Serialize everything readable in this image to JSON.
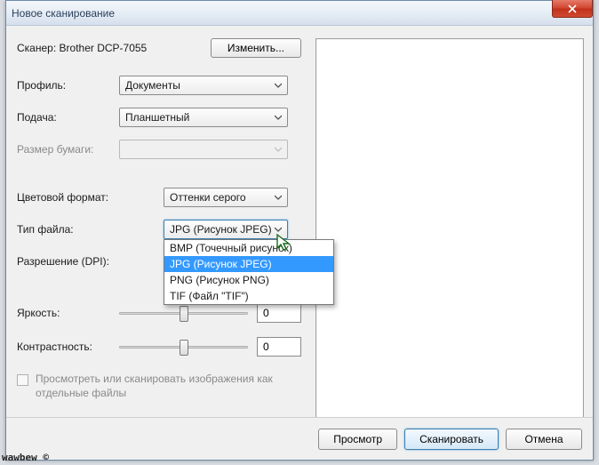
{
  "title": "Новое сканирование",
  "scanner": {
    "label": "Сканер:",
    "name": "Brother DCP-7055",
    "change_btn": "Изменить..."
  },
  "profile": {
    "label": "Профиль:",
    "value": "Документы"
  },
  "feed": {
    "label": "Подача:",
    "value": "Планшетный"
  },
  "paper_size": {
    "label": "Размер бумаги:",
    "value": ""
  },
  "color_format": {
    "label": "Цветовой формат:",
    "value": "Оттенки серого"
  },
  "file_type": {
    "label": "Тип файла:",
    "value": "JPG (Рисунок JPEG)",
    "options": [
      "BMP (Точечный рисунок)",
      "JPG (Рисунок JPEG)",
      "PNG (Рисунок PNG)",
      "TIF (Файл \"TIF\")"
    ],
    "selected_index": 1
  },
  "resolution": {
    "label": "Разрешение (DPI):",
    "value": ""
  },
  "brightness": {
    "label": "Яркость:",
    "value": "0"
  },
  "contrast": {
    "label": "Контрастность:",
    "value": "0"
  },
  "separate_files": {
    "label": "Просмотреть или сканировать изображения как отдельные файлы"
  },
  "buttons": {
    "preview": "Просмотр",
    "scan": "Сканировать",
    "cancel": "Отмена"
  },
  "watermark": "wawbew ©"
}
